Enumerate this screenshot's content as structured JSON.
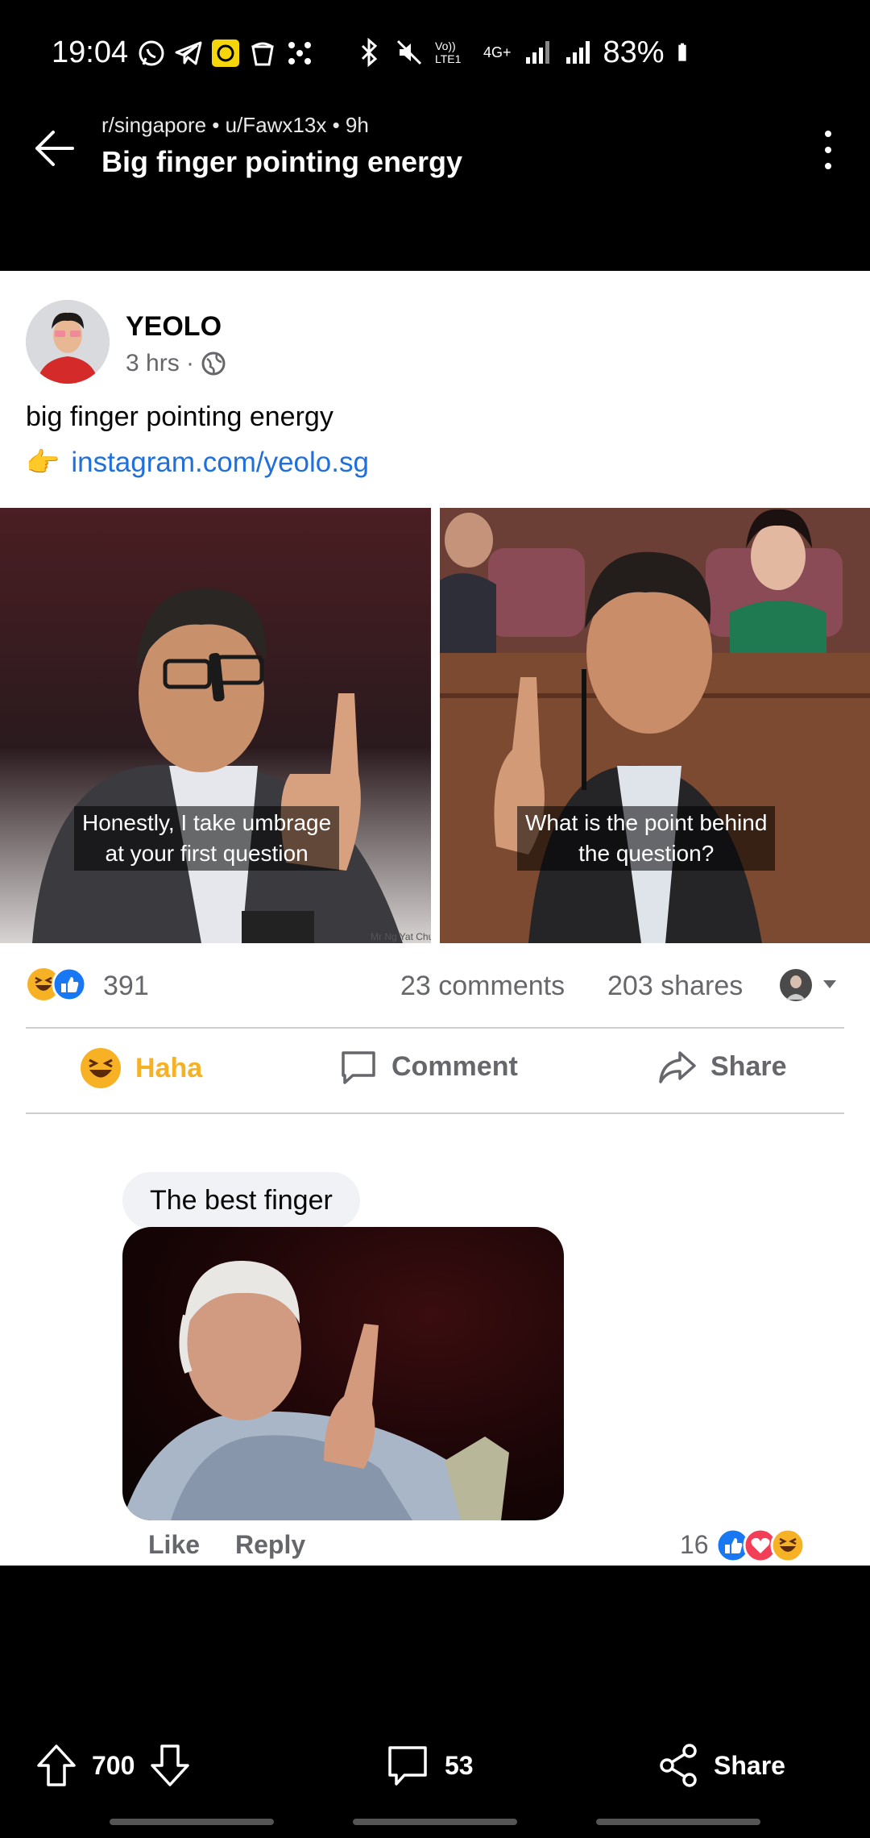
{
  "status_bar": {
    "time": "19:04",
    "network": "4G+",
    "volte": "Vo)) LTE1",
    "battery": "83%"
  },
  "header": {
    "subreddit": "r/singapore",
    "user": "u/Fawx13x",
    "age": "9h",
    "meta": "r/singapore • u/Fawx13x • 9h",
    "title": "Big finger pointing energy"
  },
  "fb_post": {
    "author": "YEOLO",
    "time": "3 hrs ·",
    "text": "big finger pointing energy",
    "link_emoji": "👉",
    "link": "instagram.com/yeolo.sg",
    "photo_left_caption_1": "Honestly, I take umbrage",
    "photo_left_caption_2": "at your first question",
    "photo_left_watermark": "Mr Ng Yat Chu",
    "photo_right_caption_1": "What is the point behind",
    "photo_right_caption_2": "the question?",
    "reaction_count": "391",
    "comments": "23 comments",
    "shares": "203 shares",
    "actions": {
      "haha": "Haha",
      "comment": "Comment",
      "share": "Share"
    },
    "comment": {
      "text": "The best finger",
      "like": "Like",
      "reply": "Reply",
      "reaction_count": "16"
    }
  },
  "bottom_bar": {
    "upvotes": "700",
    "comments": "53",
    "share": "Share"
  },
  "colors": {
    "fb_link": "#216fdb",
    "haha_yellow": "#f7b125",
    "like_blue": "#1877f2",
    "love_red": "#f33e58"
  }
}
